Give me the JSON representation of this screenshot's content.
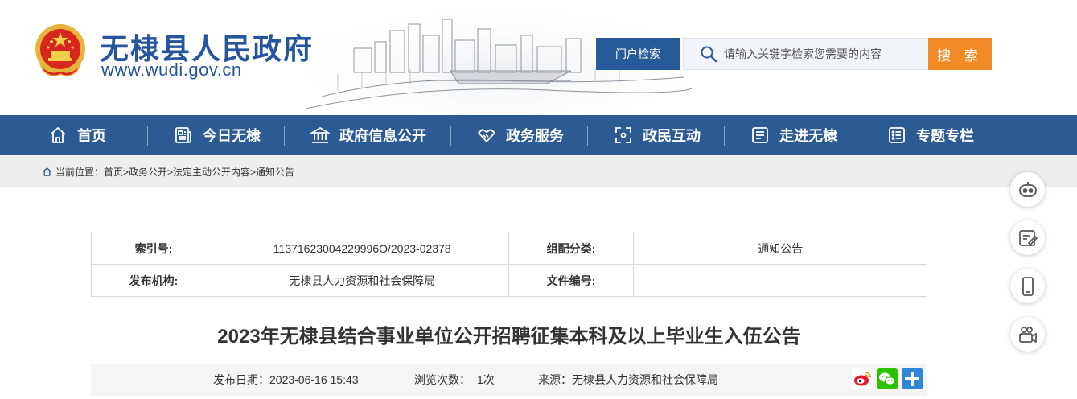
{
  "site": {
    "title": "无棣县人民政府",
    "url": "www.wudi.gov.cn"
  },
  "search": {
    "tag_label": "门户检索",
    "placeholder": "请输入关键字检索您需要的内容",
    "button_label": "搜 索"
  },
  "nav": {
    "items": [
      {
        "label": "首页",
        "icon": "home-icon"
      },
      {
        "label": "今日无棣",
        "icon": "newspaper-icon"
      },
      {
        "label": "政府信息公开",
        "icon": "government-building-icon"
      },
      {
        "label": "政务服务",
        "icon": "handshake-icon"
      },
      {
        "label": "政民互动",
        "icon": "interaction-icon"
      },
      {
        "label": "走进无棣",
        "icon": "id-card-icon"
      },
      {
        "label": "专题专栏",
        "icon": "list-icon"
      }
    ]
  },
  "breadcrumb": {
    "prefix": "当前位置：",
    "path": "首页>政务公开>法定主动公开内容>通知公告"
  },
  "info": {
    "index_label": "索引号:",
    "index_value": "11371623004229996O/2023-02378",
    "category_label": "组配分类:",
    "category_value": "通知公告",
    "publisher_label": "发布机构:",
    "publisher_value": "无棣县人力资源和社会保障局",
    "docno_label": "文件编号:",
    "docno_value": ""
  },
  "article": {
    "title": "2023年无棣县结合事业单位公开招聘征集本科及以上毕业生入伍公告",
    "publish_date_label": "发布日期：",
    "publish_date": "2023-06-16 15:43",
    "views_label": "浏览次数：",
    "views": "1次",
    "source_label": "来源：",
    "source": "无棣县人力资源和社会保障局"
  },
  "share": {
    "icons": [
      "weibo-icon",
      "wechat-icon",
      "plus-share-icon"
    ]
  },
  "side_tools": [
    "robot-assistant-icon",
    "edit-note-icon",
    "mobile-phone-icon",
    "video-camera-icon"
  ],
  "colors": {
    "brand_blue": "#2c5a93",
    "title_blue": "#25559c",
    "search_orange": "#f18a24",
    "breadcrumb_bg": "#eeeeee"
  }
}
